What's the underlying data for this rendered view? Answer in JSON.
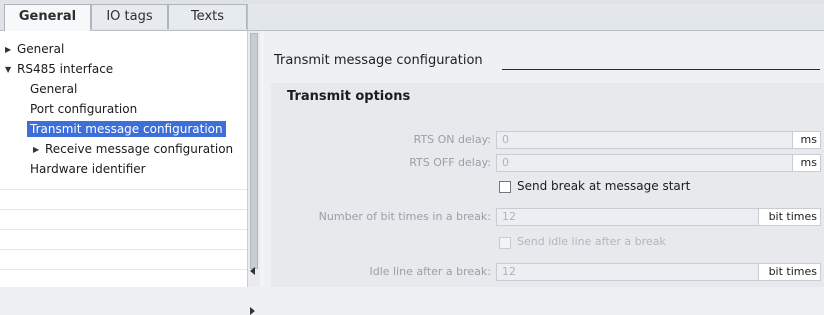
{
  "tabs": {
    "general": "General",
    "io_tags": "IO tags",
    "texts": "Texts"
  },
  "tree": {
    "general": "General",
    "rs485": "RS485 interface",
    "rs485_general": "General",
    "port_configuration": "Port configuration",
    "transmit_message_configuration": "Transmit message configuration",
    "receive_message_configuration": "Receive message configuration",
    "hardware_identifier": "Hardware identifier"
  },
  "section": {
    "title": "Transmit message configuration",
    "group_title": "Transmit options"
  },
  "fields": {
    "rts_on_delay": {
      "label": "RTS ON delay:",
      "value": "0",
      "unit": "ms"
    },
    "rts_off_delay": {
      "label": "RTS OFF delay:",
      "value": "0",
      "unit": "ms"
    },
    "send_break_label": "Send break at message start",
    "bit_times": {
      "label": "Number of bit times in a break:",
      "value": "12",
      "unit": "bit times"
    },
    "send_idle_label": "Send idle line after a break",
    "idle_line": {
      "label": "Idle line after a break:",
      "value": "12",
      "unit": "bit times"
    }
  },
  "colors": {
    "selection": "#3c6fd8",
    "panel": "#eef0f3"
  }
}
